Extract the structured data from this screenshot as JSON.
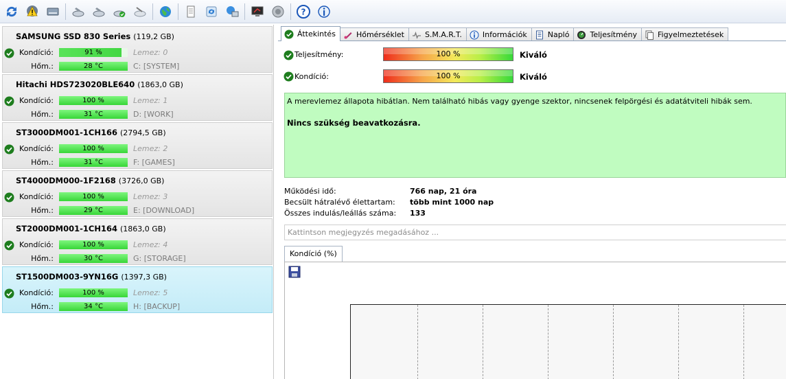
{
  "colors": {
    "ok_green": "#2aa52a",
    "bar_green": "#38d638",
    "status_bg": "#c0fcc0",
    "selected_bg": "#c4ecf8"
  },
  "toolbar": {
    "buttons": [
      "refresh-icon",
      "warning-icon",
      "disk-icon",
      "disk-settings-icon",
      "disk-settings-icon",
      "disk-ok-icon",
      "disk-tools-icon",
      "globe-icon",
      "document-icon",
      "sync-icon",
      "network-icon",
      "monitor-icon",
      "speaker-icon",
      "help-icon",
      "info-icon"
    ]
  },
  "disks": [
    {
      "name": "SAMSUNG SSD 830 Series",
      "size": "(119,2 GB)",
      "condition_label": "Kondíció:",
      "condition": "91 %",
      "condition_pct": 91,
      "temp_label": "Hőm.:",
      "temp": "28 °C",
      "disk_no": "Lemez: 0",
      "drive": "C: [SYSTEM]"
    },
    {
      "name": "Hitachi HDS723020BLE640",
      "size": "(1863,0 GB)",
      "condition_label": "Kondíció:",
      "condition": "100 %",
      "condition_pct": 100,
      "temp_label": "Hőm.:",
      "temp": "31 °C",
      "disk_no": "Lemez: 1",
      "drive": "D: [WORK]"
    },
    {
      "name": "ST3000DM001-1CH166",
      "size": "(2794,5 GB)",
      "condition_label": "Kondíció:",
      "condition": "100 %",
      "condition_pct": 100,
      "temp_label": "Hőm.:",
      "temp": "31 °C",
      "disk_no": "Lemez: 2",
      "drive": "F: [GAMES]"
    },
    {
      "name": "ST4000DM000-1F2168",
      "size": "(3726,0 GB)",
      "condition_label": "Kondíció:",
      "condition": "100 %",
      "condition_pct": 100,
      "temp_label": "Hőm.:",
      "temp": "29 °C",
      "disk_no": "Lemez: 3",
      "drive": "E: [DOWNLOAD]"
    },
    {
      "name": "ST2000DM001-1CH164",
      "size": "(1863,0 GB)",
      "condition_label": "Kondíció:",
      "condition": "100 %",
      "condition_pct": 100,
      "temp_label": "Hőm.:",
      "temp": "30 °C",
      "disk_no": "Lemez: 4",
      "drive": "G: [STORAGE]"
    },
    {
      "name": "ST1500DM003-9YN16G",
      "size": "(1397,3 GB)",
      "condition_label": "Kondíció:",
      "condition": "100 %",
      "condition_pct": 100,
      "temp_label": "Hőm.:",
      "temp": "34 °C",
      "disk_no": "Lemez: 5",
      "drive": "H: [BACKUP]",
      "selected": true
    }
  ],
  "tabs": [
    "Áttekintés",
    "Hőmérséklet",
    "S.M.A.R.T.",
    "Információk",
    "Napló",
    "Teljesítmény",
    "Figyelmeztetések"
  ],
  "overview": {
    "performance_label": "Teljesítmény:",
    "performance_value": "100 %",
    "performance_rating": "Kiváló",
    "condition_label": "Kondíció:",
    "condition_value": "100 %",
    "condition_rating": "Kiváló",
    "status_text": "A merevlemez állapota hibátlan. Nem található hibás vagy gyenge szektor, nincsenek felpörgési és adatátviteli hibák sem.",
    "status_action": "Nincs szükség beavatkozásra.",
    "uptime_label": "Működési idő:",
    "uptime_value": "766 nap, 21 óra",
    "lifetime_label": "Becsült hátralévő élettartam:",
    "lifetime_value": "több mint 1000 nap",
    "startstop_label": "Összes indulás/leállás száma:",
    "startstop_value": "133",
    "note_placeholder": "Kattintson megjegyzés megadásához ...",
    "chart_tab": "Kondíció  (%)"
  }
}
